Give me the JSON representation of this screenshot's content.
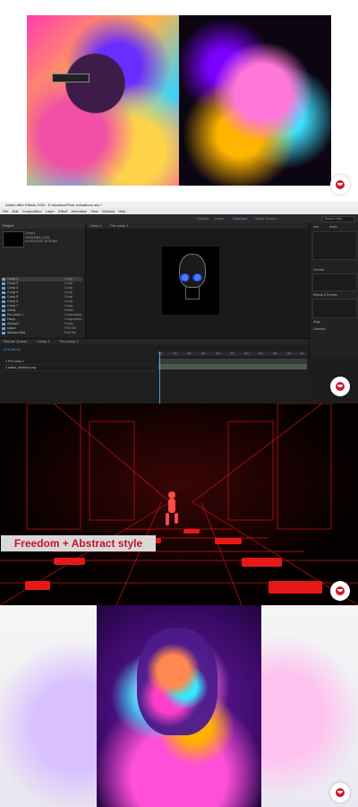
{
  "editor": {
    "title": "Adobe After Effects 2020 - D:\\Abstract\\Final animations.aep *",
    "menu": [
      "File",
      "Edit",
      "Composition",
      "Layer",
      "Effect",
      "Animation",
      "View",
      "Window",
      "Help"
    ],
    "workspaces": [
      "Default",
      "Learn",
      "Standard",
      "Small Screen"
    ],
    "active_workspace": "Standard",
    "search_placeholder": "Search Help",
    "project_tab": "Project",
    "project_info": [
      "Comp1",
      "1920x1080 (1.00)",
      "Δ 0;00;10;00, 30.00 fps"
    ],
    "project_items": [
      {
        "name": "Comp 1",
        "type": "Comp"
      },
      {
        "name": "Comp 2",
        "type": "Comp"
      },
      {
        "name": "Comp 3",
        "type": "Comp"
      },
      {
        "name": "Comp 4",
        "type": "Comp"
      },
      {
        "name": "Comp 5",
        "type": "Comp"
      },
      {
        "name": "Comp 6",
        "type": "Comp"
      },
      {
        "name": "Comp 7",
        "type": "Comp"
      },
      {
        "name": "Solids",
        "type": "Folder"
      },
      {
        "name": "Pre-comp 1",
        "type": "Composition"
      },
      {
        "name": "Ramp",
        "type": "Composition"
      },
      {
        "name": "Abstract",
        "type": "Folder"
      },
      {
        "name": "statue",
        "type": "PNG file"
      },
      {
        "name": "Abstract final",
        "type": "PNG file"
      }
    ],
    "comp_tabs": [
      "Comp 1",
      "Pre-comp 1"
    ],
    "comp_zoom": "(25%)",
    "comp_time": "0;00;00;00",
    "side_panels": [
      "Info",
      "Audio",
      "Preview",
      "Effects & Presets",
      "Align",
      "Libraries"
    ],
    "timeline_tabs": [
      "Render Queue",
      "Comp 1",
      "Pre-comp 1"
    ],
    "timeline_time": "0;00;00;00",
    "layers": [
      "1  Pre-comp 1",
      "2  statue_abstract.png"
    ],
    "ruler": [
      "00s",
      "01s",
      "02s",
      "03s",
      "04s",
      "05s",
      "06s",
      "07s",
      "08s",
      "09s",
      "10s"
    ]
  },
  "caption": "Freedom + Abstract style"
}
